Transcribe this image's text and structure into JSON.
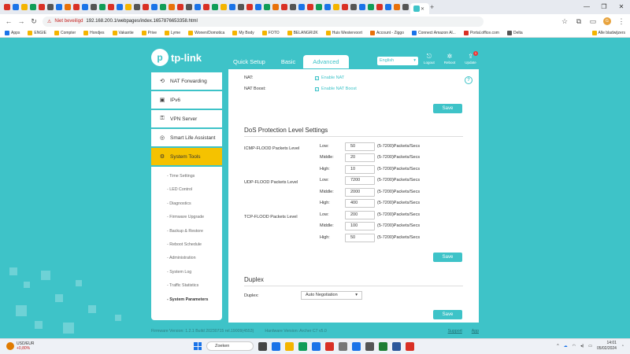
{
  "browser": {
    "address": {
      "security_label": "Niet beveiligd",
      "url": "192.168.200.1/webpages/index.1657876653358.html"
    },
    "profile_initial": "G",
    "bookmarks": [
      "Apps",
      "ENGIE",
      "Compter",
      "Hondjes",
      "Vakantie",
      "Prive",
      "Lyme",
      "Wonen/Domotica",
      "My Body",
      "FOTO",
      "BELANGRIJK",
      "Huis Westervoort",
      "Account - Ziggo",
      "Connect Amazon Al...",
      "Portal.office.com",
      "Delta"
    ],
    "all_bookmarks": "Alle bladwijzers",
    "window_controls": [
      "—",
      "❐",
      "✕"
    ]
  },
  "router": {
    "logo": "tp-link",
    "tabs": [
      "Quick Setup",
      "Basic",
      "Advanced"
    ],
    "language": "English",
    "tools": [
      "Logout",
      "Reboot",
      "Update"
    ],
    "update_badge": "1"
  },
  "sidebar": {
    "items": [
      {
        "label": "NAT Forwarding",
        "icon": "⟲"
      },
      {
        "label": "IPv6",
        "icon": "▣"
      },
      {
        "label": "VPN Server",
        "icon": "⚿"
      },
      {
        "label": "Smart Life Assistant",
        "icon": "◎"
      },
      {
        "label": "System Tools",
        "icon": "⚙"
      }
    ],
    "sub_items": [
      "Time Settings",
      "LED Control",
      "Diagnostics",
      "Firmware Upgrade",
      "Backup & Restore",
      "Reboot Schedule",
      "Administration",
      "System Log",
      "Traffic Statistics",
      "System Parameters"
    ]
  },
  "nat": {
    "nat_label": "NAT:",
    "nat_check": "Enable NAT",
    "boost_label": "NAT Boost:",
    "boost_check": "Enable NAT Boost"
  },
  "save_label": "Save",
  "dos": {
    "title": "DoS Protection Level Settings",
    "groups": [
      {
        "label": "ICMP-FLOOD Packets Level",
        "low": "50",
        "middle": "20",
        "high": "10"
      },
      {
        "label": "UDP-FLOOD Packets Level",
        "low": "7200",
        "middle": "2000",
        "high": "400"
      },
      {
        "label": "TCP-FLOOD Packets Level",
        "low": "200",
        "middle": "100",
        "high": "50"
      }
    ],
    "low_label": "Low:",
    "middle_label": "Middle:",
    "high_label": "High:",
    "unit": "(5-7200)Packets/Secs"
  },
  "duplex": {
    "title": "Duplex",
    "label": "Duplex:",
    "value": "Auto Negotiation"
  },
  "footer": {
    "firmware": "Firmware Version: 1.2.1 Build 20230715 rel.19009(4553)",
    "hardware": "Hardware Version: Archer C7 v5.0",
    "support": "Support",
    "app": "App"
  },
  "taskbar": {
    "ticker": "USD/EUR",
    "ticker_change": "+0,80%",
    "search": "Zoeken",
    "time": "14:01",
    "date": "05/02/2024"
  }
}
